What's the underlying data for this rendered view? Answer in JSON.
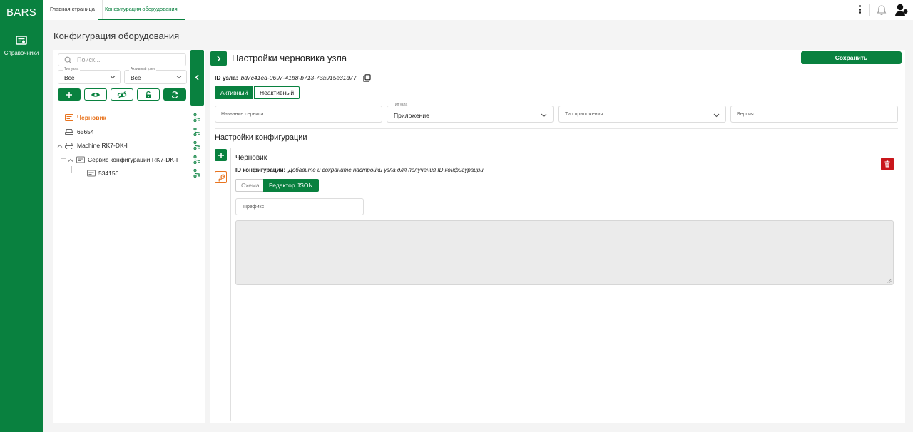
{
  "app": {
    "brand": "BARS"
  },
  "rail": {
    "items": [
      {
        "label": "Справочники",
        "icon": "catalog-icon"
      }
    ]
  },
  "topbar": {
    "tabs": [
      {
        "label": "Главная страница"
      },
      {
        "label": "Конфигурация оборудования",
        "active": true
      }
    ],
    "icons": [
      "kebab-menu-icon",
      "bell-icon",
      "user-avatar-icon"
    ]
  },
  "page": {
    "title": "Конфигурация оборудования"
  },
  "sidebar": {
    "search_placeholder": "Поиск...",
    "node_type": {
      "label": "Тип узла",
      "value": "Все"
    },
    "active_node": {
      "label": "Активный узел",
      "value": "Все"
    },
    "tools": [
      "add-icon",
      "eye-icon",
      "eye-off-icon",
      "unlock-icon",
      "refresh-icon"
    ],
    "tree": [
      {
        "label": "Черновик",
        "level": 0,
        "icon": "draft-icon",
        "highlight": true
      },
      {
        "label": "65654",
        "level": 0,
        "icon": "device-icon"
      },
      {
        "label": "Machine RK7-DK-I",
        "level": 0,
        "icon": "device-icon",
        "expanded": true
      },
      {
        "label": "Сервис конфигурации RK7-DK-I",
        "level": 1,
        "icon": "service-icon",
        "expanded": true
      },
      {
        "label": "534156",
        "level": 2,
        "icon": "service-icon"
      }
    ]
  },
  "main": {
    "title": "Настройки черновика узла",
    "save_label": "Сохранить",
    "node_id_label": "ID узла:",
    "node_id_value": "bd7c41ed-0697-41b8-b713-73a915e31d77",
    "status": {
      "active": "Активный",
      "inactive": "Неактивный",
      "selected": "Активный"
    },
    "fields": {
      "service_name": {
        "placeholder": "Название сервиса"
      },
      "node_type": {
        "label": "Тип узла",
        "value": "Приложение"
      },
      "app_type": {
        "placeholder": "Тип приложения"
      },
      "version": {
        "placeholder": "Версия"
      }
    },
    "config_section_title": "Настройки конфигурации",
    "config": {
      "name": "Черновик",
      "id_label": "ID конфигурации:",
      "id_hint": "Добавьте и сохраните настройки узла для получения ID конфигурации",
      "tabs": {
        "schema": "Схема",
        "json": "Редактор JSON",
        "selected": "Редактор JSON"
      },
      "prefix_placeholder": "Префикс",
      "json_text": ""
    }
  },
  "colors": {
    "accent": "#09813f",
    "draft": "#e8741f",
    "danger": "#c9161b"
  }
}
